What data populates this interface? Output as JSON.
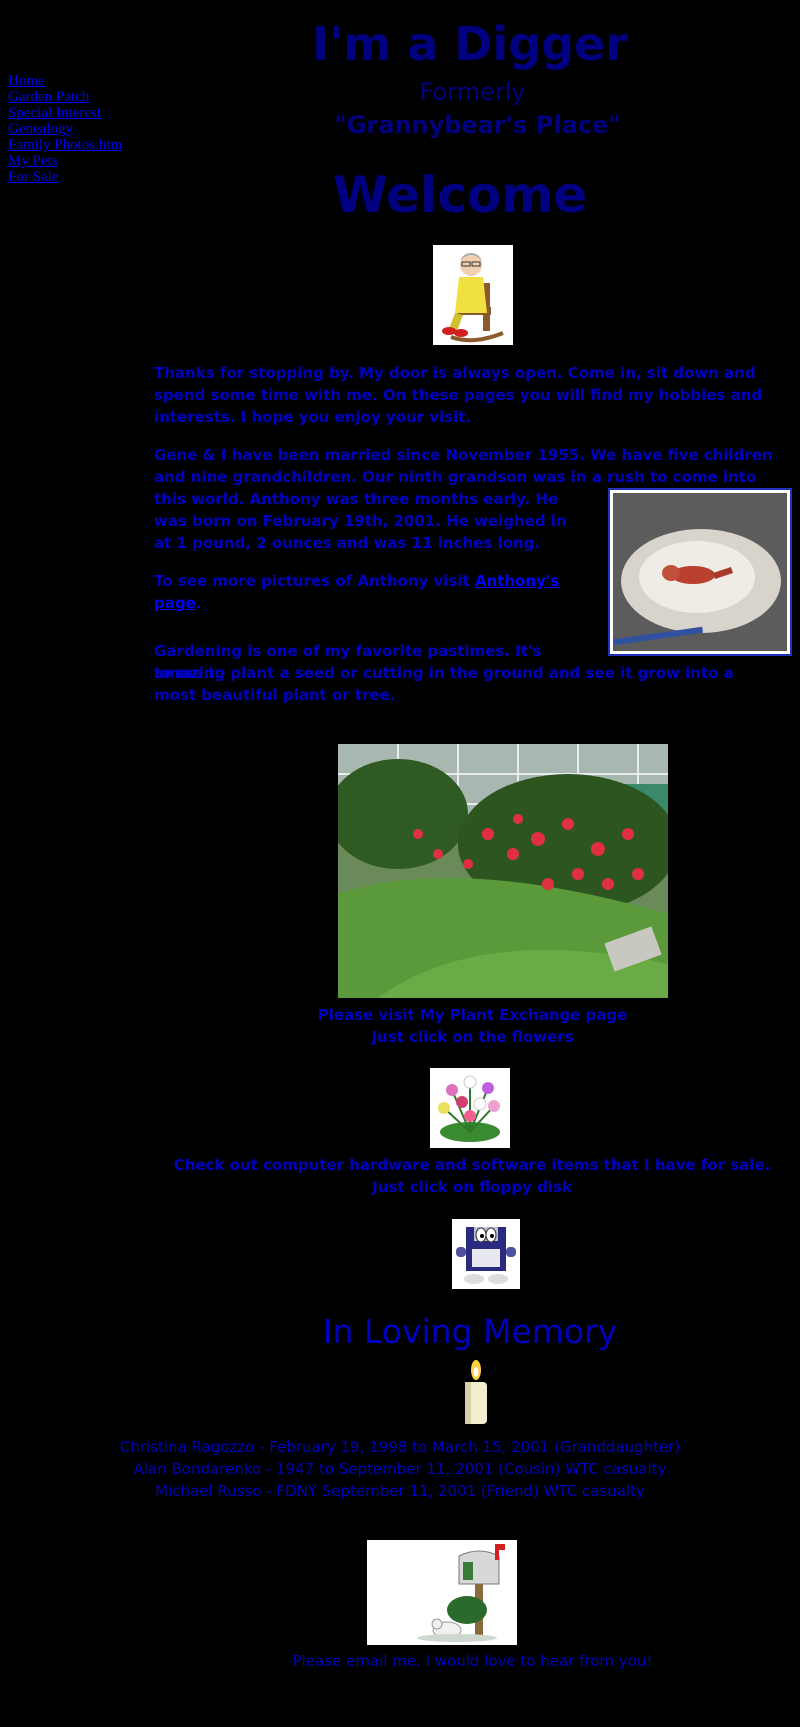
{
  "nav": {
    "items": [
      "Home",
      "Garden Patch",
      "Special Interest",
      "Genealogy",
      "Family Photos.htm",
      "My Pets",
      "For Sale"
    ]
  },
  "header": {
    "title": "I'm a Digger",
    "subtitle1": "Formerly",
    "subtitle2": "\"Grannybear's Place\"",
    "welcome": "Welcome"
  },
  "intro": {
    "p1": "Thanks for stopping by.  My door is always open.  Come in, sit down and spend some time with me.  On these pages you will find my hobbies and interests.  I hope you enjoy your visit.",
    "p2a": "Gene & I have been married since November 1955.  We have five children and nine grandchildren. Our ninth grandson was in a rush to come into",
    "p2b": "this world. Anthony was three months early. He was born on February 19th, 2001.  He weighed in at  1 pound, 2 ounces and was 11 inches long.",
    "p3_prefix": "To see more pictures of Anthony visit ",
    "p3_link": "Anthony's page",
    "p3_suffix": ".",
    "p4a": "Gardening is one of my favorite pastimes.  It's amazing",
    "p4b": "to me to plant a seed or cutting in the ground and see it grow into a most beautiful plant or tree."
  },
  "plant": {
    "caption1": "Please visit My Plant Exchange page",
    "caption2": "Just click on the flowers"
  },
  "sale": {
    "text": "Check out computer hardware and software items that I have for sale.  Just click on floppy disk"
  },
  "memory": {
    "heading": "In Loving Memory",
    "lines": [
      "Christina Ragozzo - February 19, 1998 to March 15, 2001 (Granddaughter)",
      "Alan Bondarenko  - 1947 to September 11, 2001 (Cousin) WTC casualty",
      "Michael Russo - FDNY September 11, 2001 (Friend) WTC casualty"
    ]
  },
  "email": {
    "text": "Please email me.  I would love to hear from you!"
  },
  "icons": [
    "grandma-rocking-chair-icon",
    "baby-photo",
    "garden-photo",
    "flower-bouquet-icon",
    "floppy-disk-icon",
    "candle-icon",
    "mailbox-icon"
  ]
}
